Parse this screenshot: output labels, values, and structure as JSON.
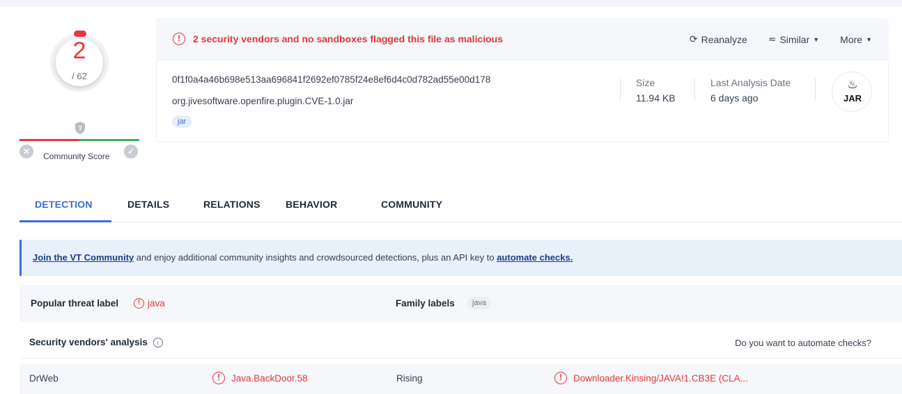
{
  "score": {
    "detections": "2",
    "total": "/ 62",
    "community_label": "Community Score"
  },
  "alert": {
    "message": "2 security vendors and no sandboxes flagged this file as malicious"
  },
  "actions": {
    "reanalyze": "Reanalyze",
    "similar": "Similar",
    "more": "More"
  },
  "file": {
    "hash": "0f1f0a4a46b698e513aa696841f2692ef0785f24e8ef6d4c0d782ad55e00d178",
    "name": "org.jivesoftware.openfire.plugin.CVE-1.0.jar",
    "tag": "jar",
    "size_label": "Size",
    "size_value": "11.94 KB",
    "date_label": "Last Analysis Date",
    "date_value": "6 days ago",
    "type_badge": "JAR"
  },
  "tabs": [
    {
      "label": "DETECTION",
      "active": true
    },
    {
      "label": "DETAILS",
      "active": false
    },
    {
      "label": "RELATIONS",
      "active": false
    },
    {
      "label": "BEHAVIOR",
      "active": false
    },
    {
      "label": "COMMUNITY",
      "active": false
    }
  ],
  "banner": {
    "link1": "Join the VT Community",
    "middle": " and enjoy additional community insights and crowdsourced detections, plus an API key to ",
    "link2": "automate checks."
  },
  "labels": {
    "threat_label": "Popular threat label",
    "threat_value": "java",
    "family_label": "Family labels",
    "family_value": "java"
  },
  "vendors": {
    "title": "Security vendors' analysis",
    "automate_prompt": "Do you want to automate checks?",
    "rows": [
      {
        "vendor1": "DrWeb",
        "result1": "Java.BackDoor.58",
        "vendor2": "Rising",
        "result2": "Downloader.Kinsing/JAVA!1.CB3E (CLA..."
      }
    ]
  },
  "colors": {
    "malicious": "#e5373d",
    "accent": "#3b6cd4",
    "positive": "#3fb25b"
  },
  "icons": [
    "alert-circle-icon",
    "refresh-icon",
    "similar-icon",
    "caret-down-icon",
    "question-icon",
    "thumbs-down-icon",
    "thumbs-up-icon",
    "java-cup-icon",
    "info-icon"
  ]
}
